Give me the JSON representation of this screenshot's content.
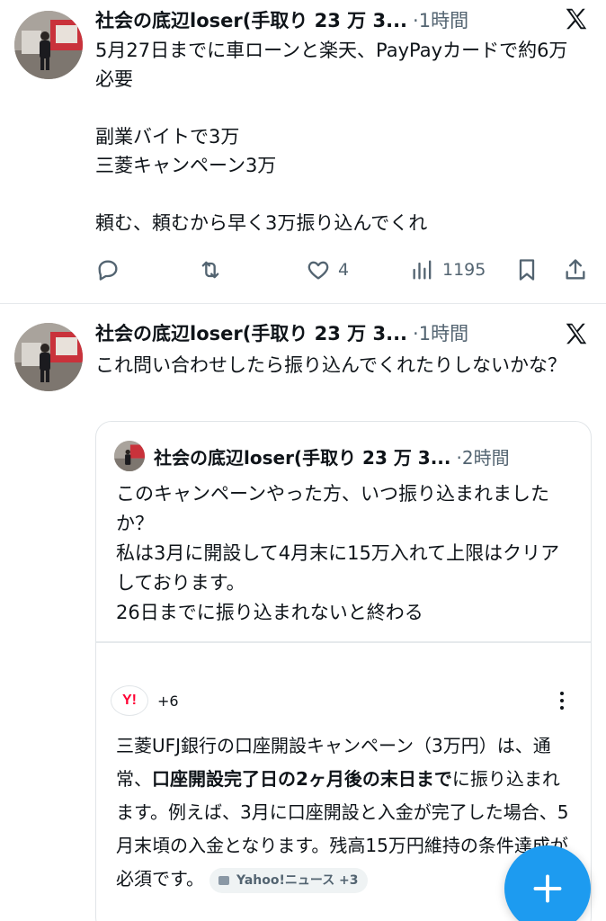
{
  "colors": {
    "accent": "#1d9bf0",
    "muted": "#536471",
    "text": "#0f1419",
    "divider": "#e6e9ec"
  },
  "tweets": [
    {
      "author": "社会の底辺loser(手取り 23 万 3...",
      "time": "·1時間",
      "text": "5月27日までに車ローンと楽天、PayPayカードで約6万必要\n\n副業バイトで3万\n三菱キャンペーン3万\n\n頼む、頼むから早く3万振り込んでくれ",
      "likes": "4",
      "views": "1195",
      "icons": [
        "reply-icon",
        "retweet-icon",
        "like-icon",
        "views-icon",
        "bookmark-icon",
        "share-icon"
      ]
    },
    {
      "author": "社会の底辺loser(手取り 23 万 3...",
      "time": "·1時間",
      "text": "これ問い合わせしたら振り込んでくれたりしないかな？",
      "quote": {
        "author": "社会の底辺loser(手取り 23 万 3...",
        "time": "·2時間",
        "text": "このキャンペーンやった方、いつ振り込まれましたか？\n私は3月に開設して4月末に15万入れて上限はクリアしております。\n26日までに振り込まれないと終わる",
        "source_logo": "Y!",
        "source_count": "+6",
        "note_part1": "三菱UFJ銀行の口座開設キャンペーン（3万円）は、通常、",
        "note_bold": "口座開設完了日の2ヶ月後の末日まで",
        "note_part2": "に振り込まれます。例えば、3月に口座開設と入金が完了した場合、5月末頃の入金となります。残高15万円維持の条件達成が必須です。",
        "cite_label": "Yahoo!ニュース +3"
      }
    }
  ],
  "fab": {
    "icon": "plus-icon"
  }
}
